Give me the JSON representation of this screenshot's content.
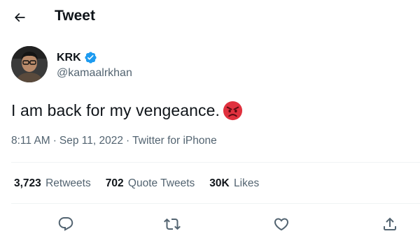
{
  "header": {
    "title": "Tweet",
    "back_icon": "arrow-left-icon"
  },
  "author": {
    "display_name": "KRK",
    "handle": "@kamaalrkhan",
    "verified_icon": "verified-badge-icon",
    "verified_color": "#1d9bf0"
  },
  "tweet": {
    "text": "I am back for my vengeance.",
    "emoji_icon": "angry-face-emoji"
  },
  "meta": {
    "time": "8:11 AM",
    "separator": "·",
    "date": "Sep 11, 2022",
    "source": "Twitter for iPhone"
  },
  "stats": [
    {
      "count": "3,723",
      "label": "Retweets"
    },
    {
      "count": "702",
      "label": "Quote Tweets"
    },
    {
      "count": "30K",
      "label": "Likes"
    }
  ],
  "actions": [
    "reply-icon",
    "retweet-icon",
    "like-icon",
    "share-icon"
  ],
  "colors": {
    "text": "#0f1419",
    "secondary": "#536471",
    "divider": "#eff3f4",
    "accent": "#1d9bf0"
  }
}
